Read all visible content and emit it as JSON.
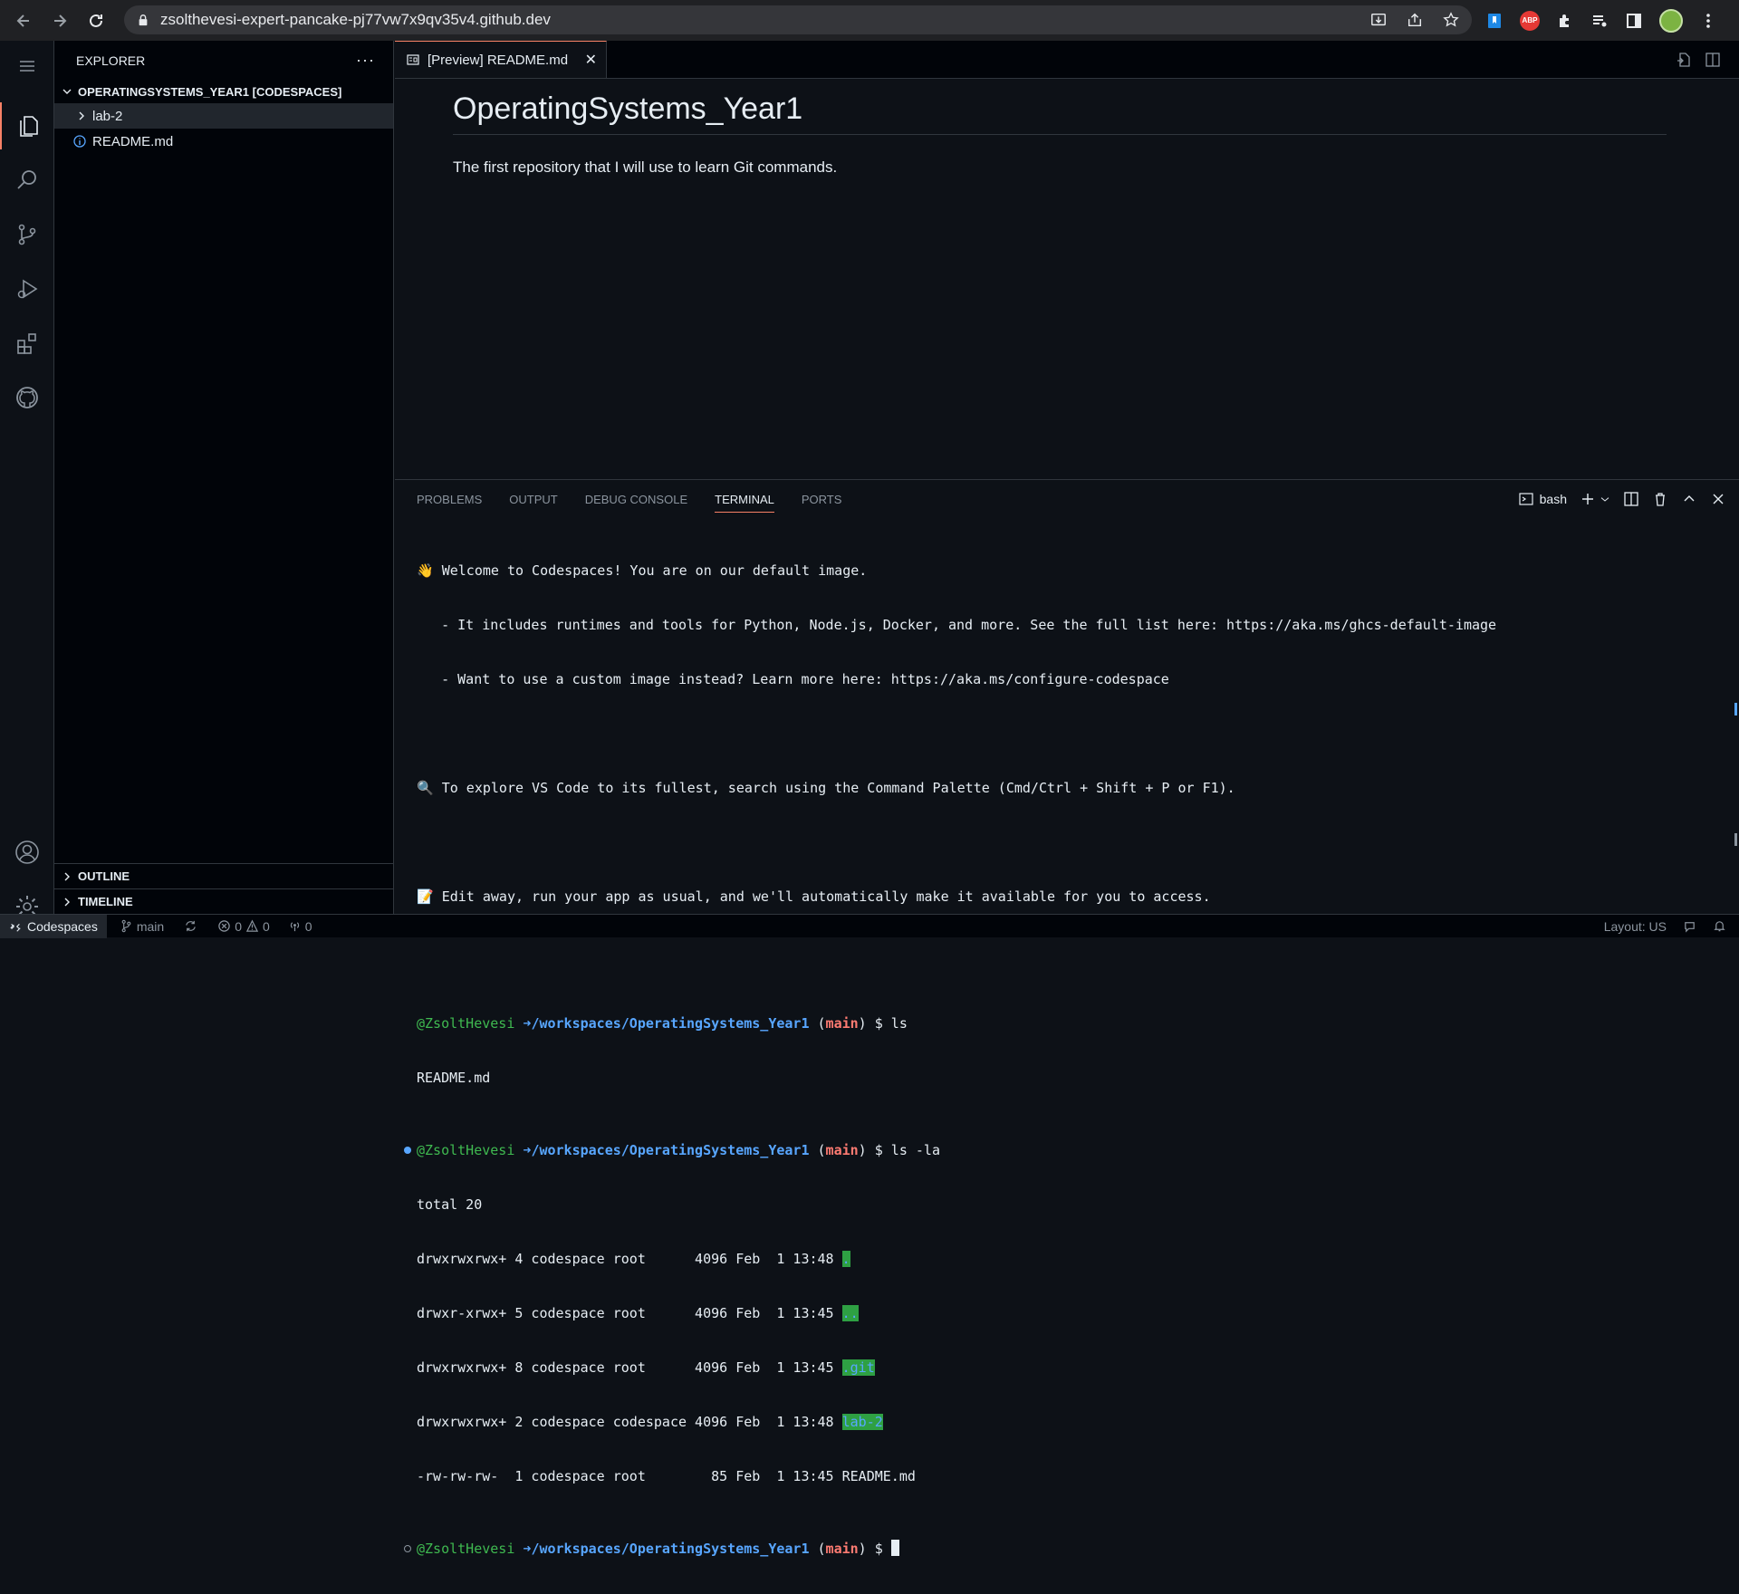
{
  "browser": {
    "url": "zsolthevesi-expert-pancake-pj77vw7x9qv35v4.github.dev",
    "abp_label": "ABP"
  },
  "sidebar": {
    "title": "EXPLORER",
    "more": "···",
    "workspace": "OPERATINGSYSTEMS_YEAR1 [CODESPACES]",
    "items": [
      {
        "label": "lab-2",
        "type": "folder"
      },
      {
        "label": "README.md",
        "type": "file"
      }
    ],
    "outline": "OUTLINE",
    "timeline": "TIMELINE"
  },
  "editor": {
    "tab_label": "[Preview] README.md",
    "tab_close": "✕",
    "heading": "OperatingSystems_Year1",
    "paragraph": "The first repository that I will use to learn Git commands."
  },
  "panel": {
    "tabs": [
      "PROBLEMS",
      "OUTPUT",
      "DEBUG CONSOLE",
      "TERMINAL",
      "PORTS"
    ],
    "active_tab": "TERMINAL",
    "shell": "bash"
  },
  "terminal": {
    "welcome": "👋 Welcome to Codespaces! You are on our default image.",
    "welcome2": "   - It includes runtimes and tools for Python, Node.js, Docker, and more. See the full list here: https://aka.ms/ghcs-default-image",
    "welcome3": "   - Want to use a custom image instead? Learn more here: https://aka.ms/configure-codespace",
    "tip": "🔍 To explore VS Code to its fullest, search using the Command Palette (Cmd/Ctrl + Shift + P or F1).",
    "edit": "📝 Edit away, run your app as usual, and we'll automatically make it available for you to access.",
    "user": "@ZsoltHevesi",
    "arrow": "➜",
    "path": "/workspaces/OperatingSystems_Year1",
    "branch": "main",
    "prompt": "$",
    "cmd1": "ls",
    "out1": "README.md",
    "cmd2": "ls -la",
    "total": "total 20",
    "listing": [
      {
        "meta": "drwxrwxrwx+ 4 codespace root      4096 Feb  1 13:48 ",
        "name": ".",
        "dir": true
      },
      {
        "meta": "drwxr-xrwx+ 5 codespace root      4096 Feb  1 13:45 ",
        "name": "..",
        "dir": true
      },
      {
        "meta": "drwxrwxrwx+ 8 codespace root      4096 Feb  1 13:45 ",
        "name": ".git",
        "dir": true
      },
      {
        "meta": "drwxrwxrwx+ 2 codespace codespace 4096 Feb  1 13:48 ",
        "name": "lab-2",
        "dir": true
      },
      {
        "meta": "-rw-rw-rw-  1 codespace root        85 Feb  1 13:45 ",
        "name": "README.md",
        "dir": false
      }
    ]
  },
  "statusbar": {
    "remote": "Codespaces",
    "branch": "main",
    "errors": "0",
    "warnings": "0",
    "ports": "0",
    "layout": "Layout: US"
  },
  "colors": {
    "accent": "#f78166",
    "background": "#0d1117",
    "dir_highlight": "#2ea043",
    "link": "#58a6ff"
  }
}
